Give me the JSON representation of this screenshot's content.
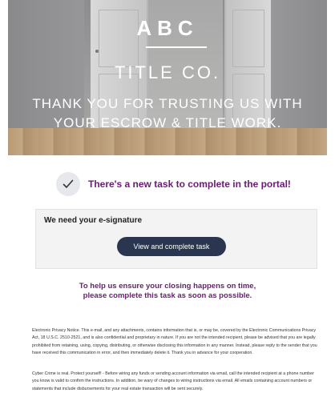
{
  "header": {
    "logo_abc": "ABC",
    "logo_title_co": "TITLE CO.",
    "tagline_line1": "THANK YOU FOR TRUSTING US WITH",
    "tagline_line2": "YOUR ESCROW & TITLE WORK."
  },
  "task": {
    "headline": "There's a new task to complete in the portal!",
    "icon": "checkmark-icon"
  },
  "card": {
    "title": "We need your e-signature",
    "button_label": "View and complete task"
  },
  "reminder": {
    "line1": "To help us ensure your closing happens on time,",
    "line2": "please complete this task as soon as possible."
  },
  "legal": {
    "privacy": "Electronic Privacy Notice. This e-mail, and any attachments, contains information that is, or may be, covered by the Electronic Communications Privacy Act, 18 U.S.C. 2510-2521, and is also confidential and proprietary in nature. If you are not the intended recipient, please be advised that you are legally prohibited from retaining, using, copying, distributing, or otherwise disclosing this information in any manner. Instead, please reply to the sender that you have received this communication in error, and then immediately delete it. Thank you in advance for your cooperation.",
    "cyber": "Cyber Crime is real. Protect yourself! - Before wiring any funds or sending account information via email, call the intended recipient at a phone number you know is valid to confirm the instructions. In addition, be wary of changes to wiring instructions via email. All emails containing account numbers or statements that include disbursements for your real estate transaction will be sent securely."
  },
  "colors": {
    "accent_purple": "#6a1b74",
    "button_navy": "#2a3550",
    "card_bg": "#f3f3f3"
  }
}
